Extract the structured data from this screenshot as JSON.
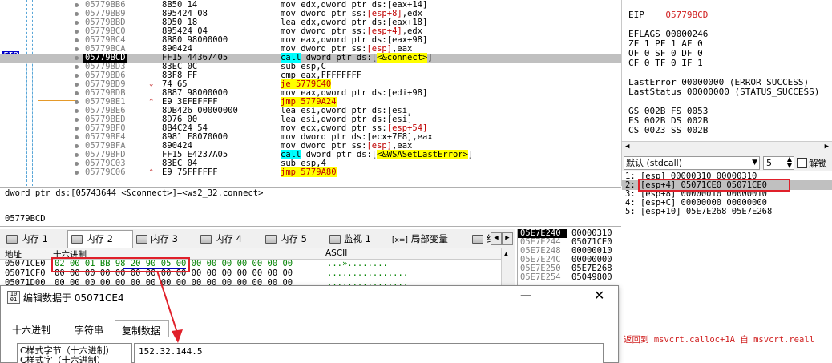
{
  "disasm": {
    "eip_label": "EIP",
    "rows": [
      {
        "addr": "05779BB6",
        "bytes": "8B50 14",
        "instr": [
          {
            "t": "mov edx,dword ptr ds:[eax+14]",
            "c": "mb"
          }
        ]
      },
      {
        "addr": "05779BB9",
        "bytes": "895424 08",
        "instr": [
          {
            "t": "mov dword ptr ss:",
            "c": "mb"
          },
          {
            "t": "[esp+8]",
            "c": "rd"
          },
          {
            "t": ",edx",
            "c": "mb"
          }
        ]
      },
      {
        "addr": "05779BBD",
        "bytes": "8D50 18",
        "instr": [
          {
            "t": "lea edx,dword ptr ds:[eax+18]",
            "c": "mb"
          }
        ]
      },
      {
        "addr": "05779BC0",
        "bytes": "895424 04",
        "instr": [
          {
            "t": "mov dword ptr ss:",
            "c": "mb"
          },
          {
            "t": "[esp+4]",
            "c": "rd"
          },
          {
            "t": ",edx",
            "c": "mb"
          }
        ]
      },
      {
        "addr": "05779BC4",
        "bytes": "8B80 98000000",
        "instr": [
          {
            "t": "mov eax,dword ptr ds:[eax+98]",
            "c": "mb"
          }
        ]
      },
      {
        "addr": "05779BCA",
        "bytes": "890424",
        "instr": [
          {
            "t": "mov dword ptr ss:",
            "c": "mb"
          },
          {
            "t": "[esp]",
            "c": "rd"
          },
          {
            "t": ",eax",
            "c": "mb"
          }
        ]
      },
      {
        "addr": "05779BCD",
        "bytes": "FF15 44367405",
        "cur": true,
        "instr": [
          {
            "t": "call",
            "c": "hl-call"
          },
          {
            "t": " dword ptr ds:[",
            "c": "mb"
          },
          {
            "t": "<&connect>",
            "c": "ylw"
          },
          {
            "t": "]",
            "c": "mb"
          }
        ]
      },
      {
        "addr": "05779BD3",
        "bytes": "83EC 0C",
        "instr": [
          {
            "t": "sub esp,C",
            "c": "mb"
          }
        ]
      },
      {
        "addr": "05779BD6",
        "bytes": "83F8 FF",
        "instr": [
          {
            "t": "cmp eax,FFFFFFFF",
            "c": "mb"
          }
        ]
      },
      {
        "addr": "05779BD9",
        "bytes": "74 65",
        "jm": "⌄",
        "instr": [
          {
            "t": "je 5779C40",
            "c": "hl-jmp"
          }
        ]
      },
      {
        "addr": "05779BDB",
        "bytes": "8B87 98000000",
        "instr": [
          {
            "t": "mov eax,dword ptr ds:[edi+98]",
            "c": "mb"
          }
        ]
      },
      {
        "addr": "05779BE1",
        "bytes": "E9 3EFEFFFF",
        "jm": "⌃",
        "instr": [
          {
            "t": "jmp 5779A24",
            "c": "hl-jmp"
          }
        ]
      },
      {
        "addr": "05779BE6",
        "bytes": "8DB426 00000000",
        "instr": [
          {
            "t": "lea esi,dword ptr ds:[esi]",
            "c": "mb"
          }
        ]
      },
      {
        "addr": "05779BED",
        "bytes": "8D76 00",
        "instr": [
          {
            "t": "lea esi,dword ptr ds:[esi]",
            "c": "mb"
          }
        ]
      },
      {
        "addr": "05779BF0",
        "bytes": "8B4C24 54",
        "instr": [
          {
            "t": "mov ecx,dword ptr ss:",
            "c": "mb"
          },
          {
            "t": "[esp+54]",
            "c": "rd"
          }
        ]
      },
      {
        "addr": "05779BF4",
        "bytes": "8981 F8070000",
        "instr": [
          {
            "t": "mov dword ptr ds:[ecx+7F8],eax",
            "c": "mb"
          }
        ]
      },
      {
        "addr": "05779BFA",
        "bytes": "890424",
        "instr": [
          {
            "t": "mov dword ptr ss:",
            "c": "mb"
          },
          {
            "t": "[esp]",
            "c": "rd"
          },
          {
            "t": ",eax",
            "c": "mb"
          }
        ]
      },
      {
        "addr": "05779BFD",
        "bytes": "FF15 E4237A05",
        "instr": [
          {
            "t": "call",
            "c": "hl-call"
          },
          {
            "t": " dword ptr ds:[",
            "c": "mb"
          },
          {
            "t": "<&WSASetLastError>",
            "c": "ylw"
          },
          {
            "t": "]",
            "c": "mb"
          }
        ]
      },
      {
        "addr": "05779C03",
        "bytes": "83EC 04",
        "instr": [
          {
            "t": "sub esp,4",
            "c": "mb"
          }
        ]
      },
      {
        "addr": "05779C06",
        "bytes": "E9 75FFFFFF",
        "jm": "⌃",
        "instr": [
          {
            "t": "jmp 5779A80",
            "c": "hl-jmp"
          }
        ]
      }
    ]
  },
  "info": {
    "line1": "dword ptr ds:[05743644 <&connect>]=<ws2_32.connect>",
    "address": "05779BCD"
  },
  "tabs": [
    {
      "label": "内存 1",
      "icon": "memory-icon"
    },
    {
      "label": "内存 2",
      "icon": "memory-icon",
      "active": true
    },
    {
      "label": "内存 3",
      "icon": "memory-icon"
    },
    {
      "label": "内存 4",
      "icon": "memory-icon"
    },
    {
      "label": "内存 5",
      "icon": "memory-icon"
    },
    {
      "label": "监视 1",
      "icon": "watch-icon"
    },
    {
      "label": "局部变量",
      "icon": "locals-icon",
      "prefix": "[x=]"
    },
    {
      "label": "结",
      "icon": "struct-icon"
    }
  ],
  "dump": {
    "col_addr": "地址",
    "col_hex": "十六进制",
    "col_ascii": "ASCII",
    "rows": [
      {
        "addr": "05071CE0",
        "hex": "02 00 01 BB 98 20 90 05 00 00 00 00 00 00 00 00",
        "ascii": "...»........"
      },
      {
        "addr": "05071CF0",
        "hex": "00 00 00 00 00 00 00 00 00 00 00 00 00 00 00 00",
        "ascii": "................"
      },
      {
        "addr": "05071D00",
        "hex": "00 00 00 00 00 00 00 00 00 00 00 00 00 00 00 00",
        "ascii": "................"
      }
    ]
  },
  "stack": {
    "addrs": [
      "05E7E240",
      "05E7E244",
      "05E7E248",
      "05E7E24C",
      "05E7E250",
      "05E7E254"
    ],
    "vals": [
      "00000310",
      "05071CE0",
      "00000010",
      "00000000",
      "05E7E268",
      "05049800"
    ]
  },
  "registers": {
    "eip_label": "EIP",
    "eip_value": "05779BCD",
    "eflags": "EFLAGS    00000246",
    "flags": [
      "ZF 1  PF 1  AF 0",
      "OF 0  SF 0  DF 0",
      "CF 0  TF 0  IF 1"
    ],
    "last": [
      "LastError  00000000 (ERROR_SUCCESS)",
      "LastStatus 00000000 (STATUS_SUCCESS)"
    ],
    "segs": [
      "GS 002B  FS 0053",
      "ES 002B  DS 002B",
      "CS 0023  SS 002B"
    ]
  },
  "callconv": {
    "value": "默认 (stdcall)",
    "count": "5",
    "unlock": "解锁"
  },
  "callstack": [
    "1: [esp] 00000310 00000310",
    "2: [esp+4]  05071CE0  05071CE0",
    "3: [esp+8] 00000010 00000010",
    "4: [esp+C] 00000000 00000000",
    "5: [esp+10] 05E7E268 05E7E268"
  ],
  "return_note": "返回到 msvcrt.calloc+1A 自 msvcrt.reall",
  "dialog": {
    "title": "编辑数据于  05071CE4",
    "tabs": [
      "十六进制",
      "字符串",
      "复制数据"
    ],
    "list": [
      "C样式字节（十六进制）",
      "C样式字（十六进制）"
    ],
    "value": "152.32.144.5"
  },
  "colors": {
    "red": "#e0202a",
    "cyan": "#00ffff",
    "yellow": "#ffff00",
    "eip": "#0000c8"
  }
}
